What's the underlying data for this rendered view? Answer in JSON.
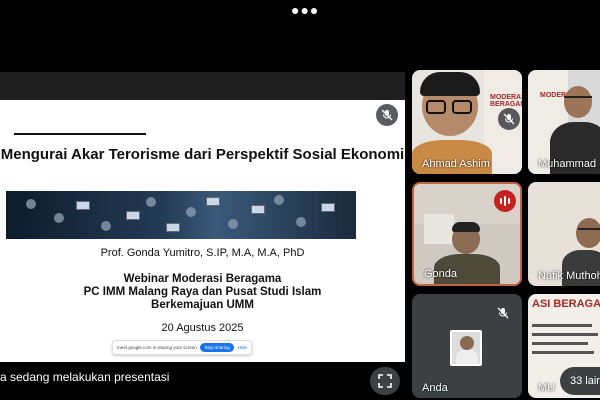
{
  "topbar": {
    "more_icon": "more-horizontal-icon"
  },
  "presentation": {
    "slide": {
      "title": "Mengurai Akar Terorisme dari Perspektif Sosial Ekonomi",
      "author": "Prof. Gonda Yumitro, S.IP, M.A, M.A, PhD",
      "event_lines": [
        "Webinar Moderasi Beragama",
        "PC IMM Malang Raya dan Pusat Studi Islam",
        "Berkemajuan UMM"
      ],
      "date": "20 Agustus 2025",
      "share_bar": {
        "text": "meet.google.com is sharing your screen.",
        "stop_label": "Stop sharing",
        "hide_label": "Hide"
      }
    },
    "pin_icon": "pin-icon",
    "mic_off_icon": "mic-off-icon",
    "caption": "a sedang melakukan presentasi",
    "fullscreen_icon": "fullscreen-icon"
  },
  "participants": [
    {
      "name": "Ahmad Ashim",
      "muted": true
    },
    {
      "name": "Muhammad",
      "muted": false
    },
    {
      "name": "Gonda",
      "muted": false,
      "speaking": true
    },
    {
      "name": "Nafik Muthohirin",
      "muted": false
    },
    {
      "name": "Anda",
      "muted": true
    },
    {
      "name": "MU",
      "muted": false
    }
  ],
  "others_label": "33 lainnya",
  "tile_posters": {
    "tile1": "MODERASI BERAGAMA",
    "tile2": "MODERASI",
    "tile6": "ASI BERAGA"
  },
  "colors": {
    "background": "#000000",
    "tile_dark": "#3c4043",
    "speaking": "#c5221f",
    "accent_blue": "#1a73e8"
  }
}
